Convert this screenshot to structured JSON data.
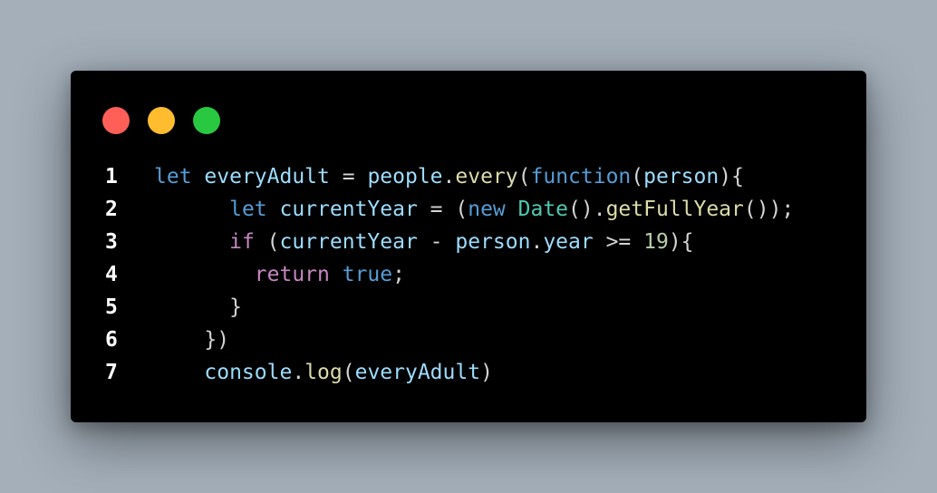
{
  "window": {
    "controls": [
      "close",
      "minimize",
      "maximize"
    ],
    "colors": {
      "close": "#ff5f57",
      "minimize": "#febc2e",
      "maximize": "#28c840",
      "background": "#000000"
    }
  },
  "code": {
    "language": "javascript",
    "lines": [
      {
        "number": "1",
        "tokens": [
          {
            "t": "let",
            "c": "kw"
          },
          {
            "t": " ",
            "c": "pun"
          },
          {
            "t": "everyAdult",
            "c": "var"
          },
          {
            "t": " = ",
            "c": "pun"
          },
          {
            "t": "people",
            "c": "var"
          },
          {
            "t": ".",
            "c": "pun"
          },
          {
            "t": "every",
            "c": "fn"
          },
          {
            "t": "(",
            "c": "pun"
          },
          {
            "t": "function",
            "c": "kw"
          },
          {
            "t": "(",
            "c": "pun"
          },
          {
            "t": "person",
            "c": "var"
          },
          {
            "t": "){",
            "c": "pun"
          }
        ]
      },
      {
        "number": "2",
        "tokens": [
          {
            "t": "      ",
            "c": "pun"
          },
          {
            "t": "let",
            "c": "kw"
          },
          {
            "t": " ",
            "c": "pun"
          },
          {
            "t": "currentYear",
            "c": "var"
          },
          {
            "t": " = (",
            "c": "pun"
          },
          {
            "t": "new",
            "c": "kw"
          },
          {
            "t": " ",
            "c": "pun"
          },
          {
            "t": "Date",
            "c": "cls"
          },
          {
            "t": "().",
            "c": "pun"
          },
          {
            "t": "getFullYear",
            "c": "fn"
          },
          {
            "t": "());",
            "c": "pun"
          }
        ]
      },
      {
        "number": "3",
        "tokens": [
          {
            "t": "      ",
            "c": "pun"
          },
          {
            "t": "if",
            "c": "ctl"
          },
          {
            "t": " (",
            "c": "pun"
          },
          {
            "t": "currentYear",
            "c": "var"
          },
          {
            "t": " - ",
            "c": "pun"
          },
          {
            "t": "person",
            "c": "var"
          },
          {
            "t": ".",
            "c": "pun"
          },
          {
            "t": "year",
            "c": "var"
          },
          {
            "t": " >= ",
            "c": "pun"
          },
          {
            "t": "19",
            "c": "num"
          },
          {
            "t": "){",
            "c": "pun"
          }
        ]
      },
      {
        "number": "4",
        "tokens": [
          {
            "t": "        ",
            "c": "pun"
          },
          {
            "t": "return",
            "c": "ctl"
          },
          {
            "t": " ",
            "c": "pun"
          },
          {
            "t": "true",
            "c": "kw"
          },
          {
            "t": ";",
            "c": "pun"
          }
        ]
      },
      {
        "number": "5",
        "tokens": [
          {
            "t": "      ",
            "c": "pun"
          },
          {
            "t": "}",
            "c": "pun"
          }
        ]
      },
      {
        "number": "6",
        "tokens": [
          {
            "t": "    ",
            "c": "pun"
          },
          {
            "t": "})",
            "c": "pun"
          }
        ]
      },
      {
        "number": "7",
        "tokens": [
          {
            "t": "    ",
            "c": "pun"
          },
          {
            "t": "console",
            "c": "var"
          },
          {
            "t": ".",
            "c": "pun"
          },
          {
            "t": "log",
            "c": "fn"
          },
          {
            "t": "(",
            "c": "pun"
          },
          {
            "t": "everyAdult",
            "c": "var"
          },
          {
            "t": ")",
            "c": "pun"
          }
        ]
      }
    ]
  }
}
